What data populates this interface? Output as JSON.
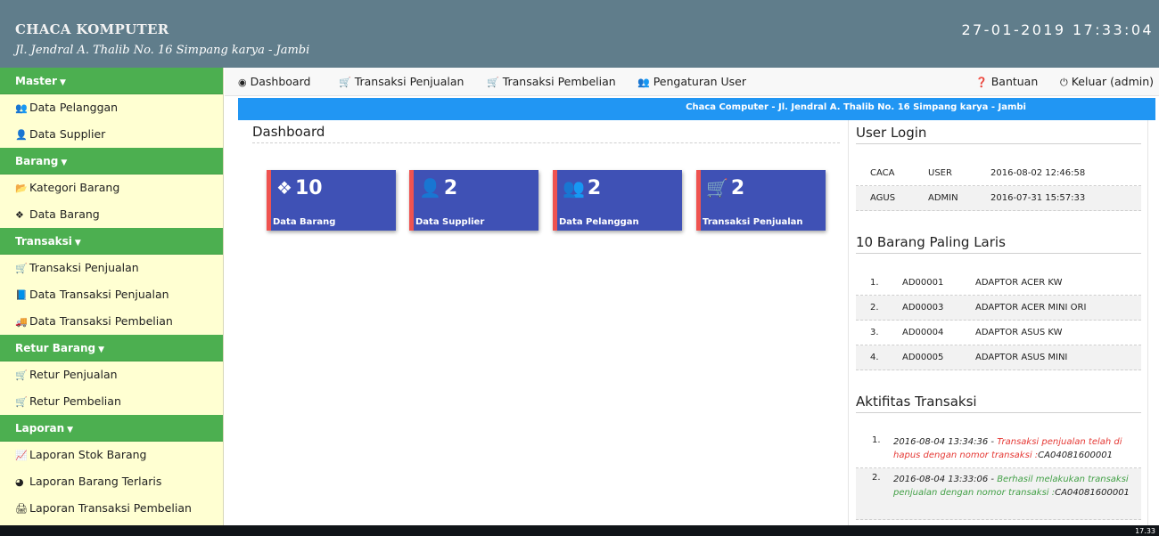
{
  "header": {
    "brand": "CHACA KOMPUTER",
    "address": "Jl. Jendral A. Thalib No. 16 Simpang karya - Jambi",
    "clock": "27-01-2019 17:33:04"
  },
  "sidebar": {
    "sections": [
      {
        "label": "Master",
        "items": [
          {
            "icon": "users-icon",
            "label": "Data Pelanggan"
          },
          {
            "icon": "user-icon",
            "label": "Data Supplier"
          }
        ]
      },
      {
        "label": "Barang",
        "items": [
          {
            "icon": "folder-icon",
            "label": "Kategori Barang"
          },
          {
            "icon": "cubes-icon",
            "label": "Data Barang"
          }
        ]
      },
      {
        "label": "Transaksi",
        "items": [
          {
            "icon": "cart-icon",
            "label": "Transaksi Penjualan"
          },
          {
            "icon": "book-icon",
            "label": "Data Transaksi Penjualan"
          },
          {
            "icon": "truck-icon",
            "label": "Data Transaksi Pembelian"
          }
        ]
      },
      {
        "label": "Retur Barang",
        "items": [
          {
            "icon": "cart-arrow-icon",
            "label": "Retur Penjualan"
          },
          {
            "icon": "cart-arrow-icon",
            "label": "Retur Pembelian"
          }
        ]
      },
      {
        "label": "Laporan",
        "items": [
          {
            "icon": "line-chart-icon",
            "label": "Laporan Stok Barang"
          },
          {
            "icon": "pie-chart-icon",
            "label": "Laporan Barang Terlaris"
          },
          {
            "icon": "print-icon",
            "label": "Laporan Transaksi Pembelian"
          }
        ]
      }
    ]
  },
  "navbar": {
    "dashboard": "Dashboard",
    "sales": "Transaksi Penjualan",
    "purchase": "Transaksi Pembelian",
    "users": "Pengaturan User",
    "help": "Bantuan",
    "logout": "Keluar (admin)"
  },
  "banner": "Chaca Computer - Jl. Jendral A. Thalib No. 16 Simpang karya - Jambi",
  "dashboard": {
    "title": "Dashboard",
    "cards": [
      {
        "icon": "cubes-icon",
        "value": "10",
        "label": "Data Barang"
      },
      {
        "icon": "user-icon",
        "value": "2",
        "label": "Data Supplier"
      },
      {
        "icon": "users-icon",
        "value": "2",
        "label": "Data Pelanggan"
      },
      {
        "icon": "cart-icon",
        "value": "2",
        "label": "Transaksi Penjualan"
      }
    ]
  },
  "user_login": {
    "title": "User Login",
    "rows": [
      {
        "name": "CACA",
        "role": "USER",
        "time": "2016-08-02 12:46:58"
      },
      {
        "name": "AGUS",
        "role": "ADMIN",
        "time": "2016-07-31 15:57:33"
      }
    ]
  },
  "top_items": {
    "title": "10 Barang Paling Laris",
    "rows": [
      {
        "no": "1.",
        "code": "AD00001",
        "name": "ADAPTOR ACER KW"
      },
      {
        "no": "2.",
        "code": "AD00003",
        "name": "ADAPTOR ACER MINI ORI"
      },
      {
        "no": "3.",
        "code": "AD00004",
        "name": "ADAPTOR ASUS KW"
      },
      {
        "no": "4.",
        "code": "AD00005",
        "name": "ADAPTOR ASUS MINI"
      }
    ]
  },
  "activity": {
    "title": "Aktifitas Transaksi",
    "rows": [
      {
        "no": "1.",
        "time": "2016-08-04 13:34:36 -",
        "message": "Transaksi penjualan telah di hapus dengan nomor transaksi :",
        "ref": "CA04081600001"
      },
      {
        "no": "2.",
        "time": "2016-08-04 13:33:06 -",
        "message": "Berhasil melakukan transaksi penjualan dengan nomor transaksi :",
        "ref": "CA04081600001"
      }
    ]
  },
  "taskbar": {
    "time": "17.33"
  },
  "colors": {
    "header": "#607d8b",
    "sidebar_head": "#4caf50",
    "sidebar_bg": "#ffffd2",
    "banner": "#2196f3",
    "card": "#3f51b5",
    "card_accent": "#ef5350"
  }
}
